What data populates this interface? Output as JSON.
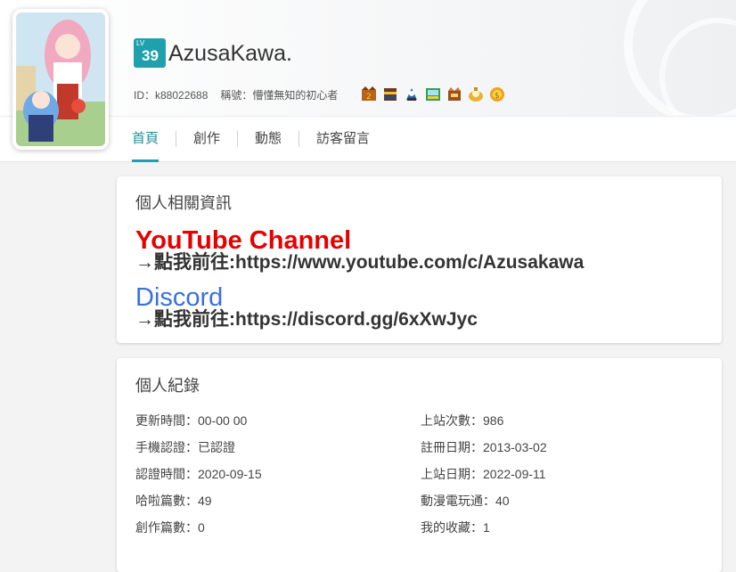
{
  "profile": {
    "level_label": "LV",
    "level": "39",
    "username": "AzusaKawa.",
    "id_text": "ID：k88022688",
    "title_text": "稱號：懵懂無知的初心者",
    "badge_icons": [
      "badge-icon-1",
      "badge-icon-2",
      "badge-icon-3",
      "badge-icon-4",
      "badge-icon-5",
      "badge-icon-6",
      "badge-icon-7"
    ]
  },
  "tabs": [
    {
      "label": "首頁",
      "active": true
    },
    {
      "label": "創作",
      "active": false
    },
    {
      "label": "動態",
      "active": false
    },
    {
      "label": "訪客留言",
      "active": false
    }
  ],
  "info_card": {
    "title": "個人相關資訊",
    "youtube_title": "YouTube Channel",
    "youtube_link": "→點我前往:https://www.youtube.com/c/Azusakawa",
    "discord_title": "Discord",
    "discord_link": "→點我前往:https://discord.gg/6xXwJyc"
  },
  "records_card": {
    "title": "個人紀錄",
    "left": [
      "更新時間：00-00 00",
      "手機認證：已認證",
      "認證時間：2020-09-15",
      "哈啦篇數：49",
      "創作篇數：0"
    ],
    "right": [
      "上站次數：986",
      "註冊日期：2013-03-02",
      "上站日期：2022-09-11",
      "動漫電玩通：40",
      "我的收藏：1"
    ]
  },
  "colors": {
    "accent": "#1ea1ad",
    "youtube_red": "#e60000",
    "discord_blue": "#3b6fe0"
  }
}
